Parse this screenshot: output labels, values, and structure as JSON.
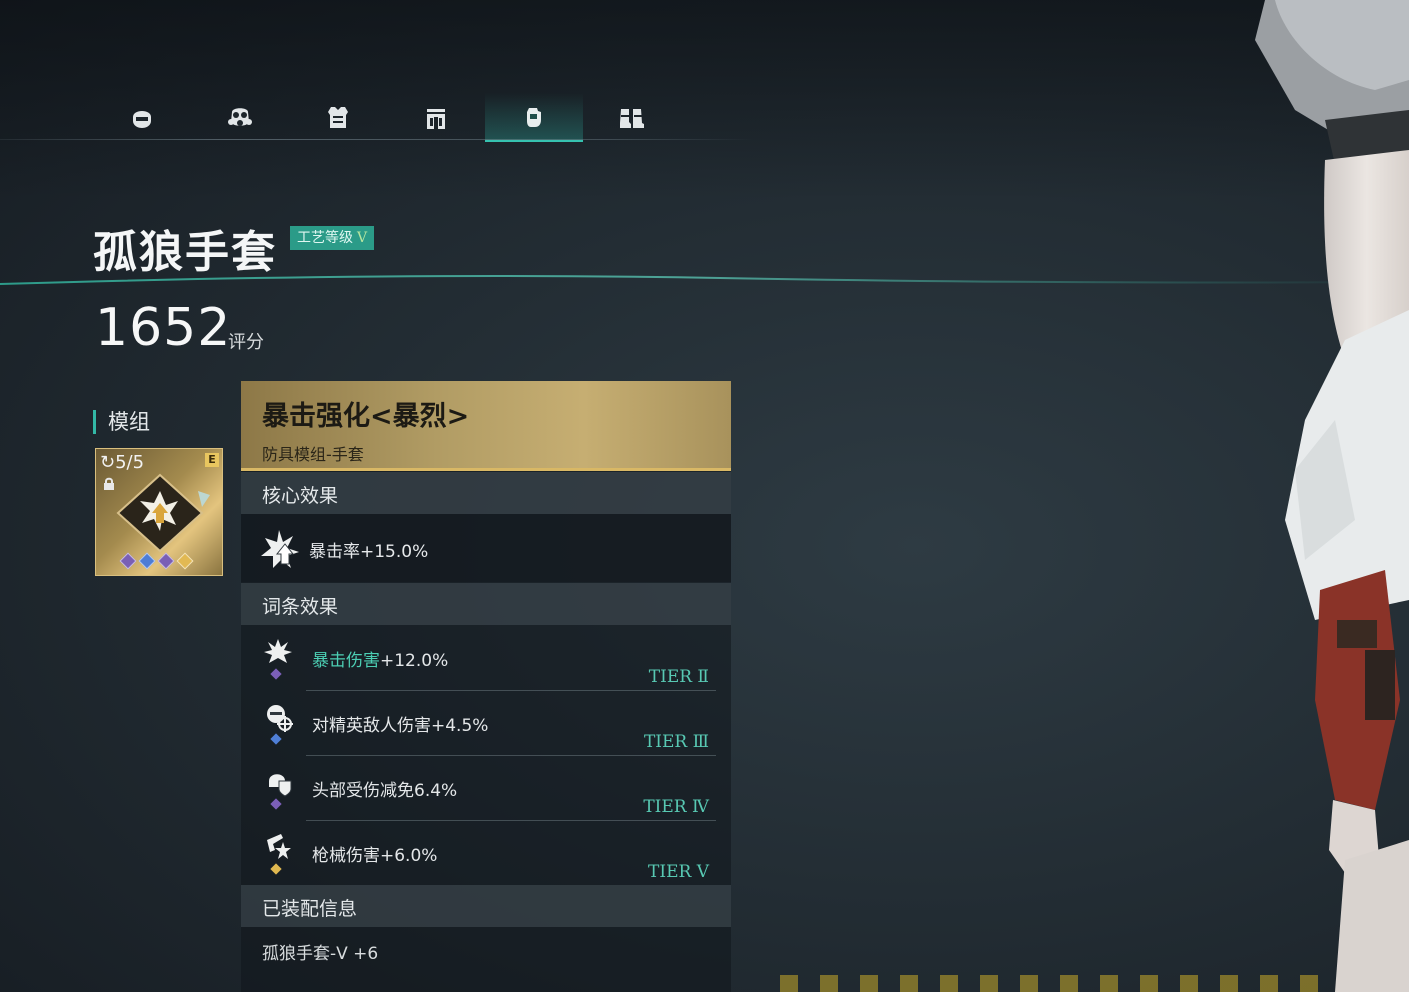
{
  "tabs": [
    {
      "icon": "helmet-icon",
      "active": false
    },
    {
      "icon": "gas-mask-icon",
      "active": false
    },
    {
      "icon": "body-armor-icon",
      "active": false
    },
    {
      "icon": "backpack-icon",
      "active": false
    },
    {
      "icon": "gloves-icon",
      "active": true
    },
    {
      "icon": "boots-icon",
      "active": false
    }
  ],
  "item": {
    "name": "孤狼手套",
    "craft_label": "工艺等级",
    "craft_level": "V",
    "score": "1652",
    "score_unit": "评分"
  },
  "mod": {
    "section_label": "模组",
    "count": "5/5",
    "grade": "E",
    "icon": "crit-boost-emblem-icon"
  },
  "panel": {
    "perk_name": "暴击强化<暴烈>",
    "perk_type": "防具模组-手套",
    "core_title": "核心效果",
    "core_effect": "暴击率+15.0%",
    "affix_title": "词条效果",
    "affixes": [
      {
        "icon": "crit-damage-icon",
        "highlight": "暴击伤害",
        "text": "+12.0%",
        "tier": "TIER Ⅱ",
        "pip_color": "#7b5fb8"
      },
      {
        "icon": "elite-enemy-icon",
        "highlight": "",
        "text": "对精英敌人伤害+4.5%",
        "tier": "TIER Ⅲ",
        "pip_color": "#4f7fd6"
      },
      {
        "icon": "head-protection-icon",
        "highlight": "",
        "text": "头部受伤减免6.4%",
        "tier": "TIER Ⅳ",
        "pip_color": "#7b5fb8"
      },
      {
        "icon": "firearm-damage-icon",
        "highlight": "",
        "text": "枪械伤害+6.0%",
        "tier": "TIER V",
        "pip_color": "#e0b850"
      }
    ],
    "equipped_title": "已装配信息",
    "equipped_info": "孤狼手套-V +6"
  },
  "colors": {
    "accent_teal": "#36c2b0",
    "gold_header": "#c6ae72"
  }
}
